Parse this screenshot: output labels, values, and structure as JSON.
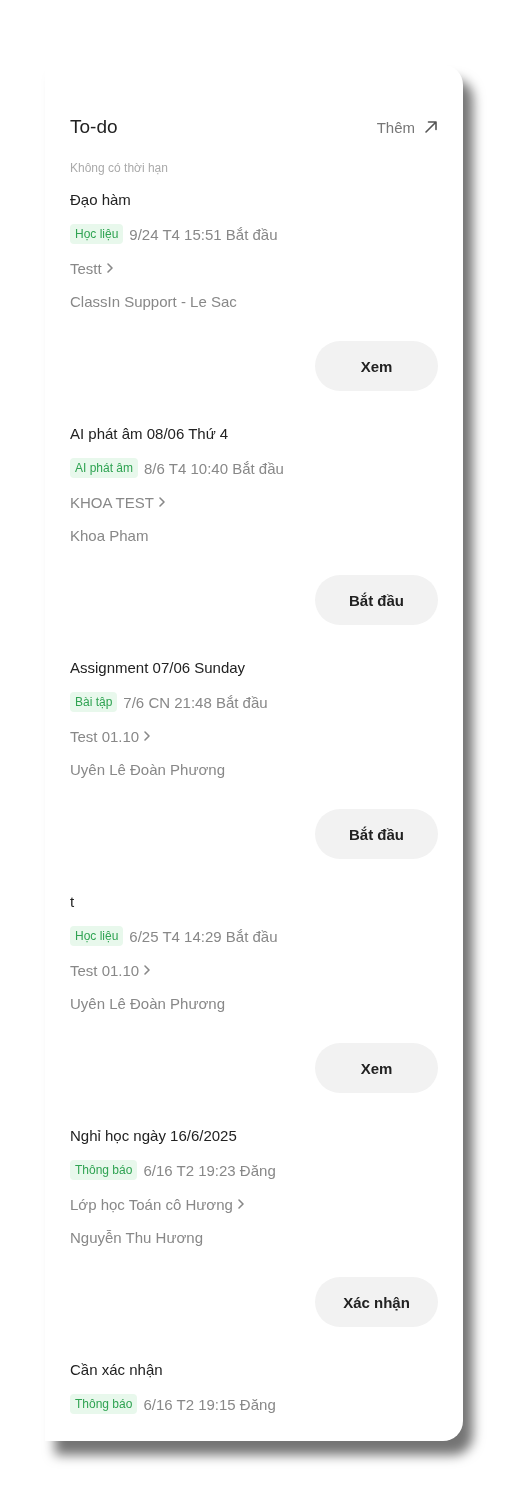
{
  "panel": {
    "title": "To-do",
    "more_link": "Thêm",
    "section_label": "Không có thời hạn"
  },
  "items": [
    {
      "title": "Đạo hàm",
      "tag": "Học liệu",
      "meta": "9/24 T4 15:51 Bắt đầu",
      "class": "Testt",
      "teacher": "ClassIn Support - Le Sac",
      "button": "Xem"
    },
    {
      "title": "AI phát âm 08/06 Thứ 4",
      "tag": "AI phát âm",
      "meta": "8/6 T4 10:40 Bắt đầu",
      "class": "KHOA TEST",
      "teacher": "Khoa Pham",
      "button": "Bắt đầu"
    },
    {
      "title": "Assignment 07/06 Sunday",
      "tag": "Bài tập",
      "meta": "7/6 CN 21:48 Bắt đầu",
      "class": "Test 01.10",
      "teacher": "Uyên Lê Đoàn Phương",
      "button": "Bắt đầu"
    },
    {
      "title": "t",
      "tag": "Học liệu",
      "meta": "6/25 T4 14:29 Bắt đầu",
      "class": "Test 01.10",
      "teacher": "Uyên Lê Đoàn Phương",
      "button": "Xem"
    },
    {
      "title": "Nghỉ học ngày 16/6/2025",
      "tag": "Thông báo",
      "meta": "6/16 T2 19:23 Đăng",
      "class": "Lớp học Toán cô Hương",
      "teacher": "Nguyễn Thu Hương",
      "button": "Xác nhận"
    },
    {
      "title": "Cần xác nhận",
      "tag": "Thông báo",
      "meta": "6/16 T2 19:15 Đăng"
    }
  ]
}
